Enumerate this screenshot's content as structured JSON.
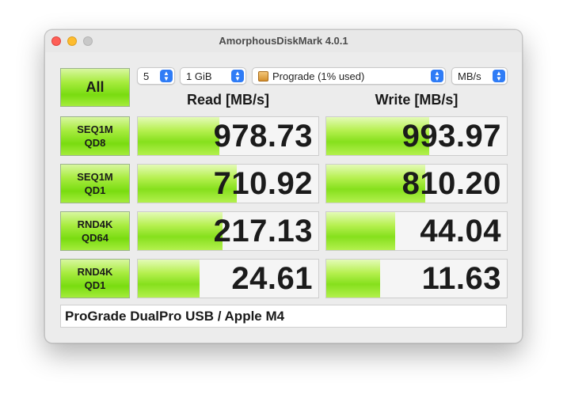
{
  "window": {
    "title": "AmorphousDiskMark 4.0.1"
  },
  "controls": {
    "all_label": "All",
    "count": "5",
    "size": "1 GiB",
    "drive": "Prograde (1% used)",
    "unit": "MB/s"
  },
  "headers": {
    "read": "Read [MB/s]",
    "write": "Write [MB/s]"
  },
  "tests": [
    {
      "line1": "SEQ1M",
      "line2": "QD8",
      "read": "978.73",
      "write": "993.97",
      "read_fill": 0.45,
      "write_fill": 0.57
    },
    {
      "line1": "SEQ1M",
      "line2": "QD1",
      "read": "710.92",
      "write": "810.20",
      "read_fill": 0.55,
      "write_fill": 0.55
    },
    {
      "line1": "RND4K",
      "line2": "QD64",
      "read": "217.13",
      "write": "44.04",
      "read_fill": 0.47,
      "write_fill": 0.38
    },
    {
      "line1": "RND4K",
      "line2": "QD1",
      "read": "24.61",
      "write": "11.63",
      "read_fill": 0.34,
      "write_fill": 0.3
    }
  ],
  "description": "ProGrade DualPro USB / Apple M4"
}
